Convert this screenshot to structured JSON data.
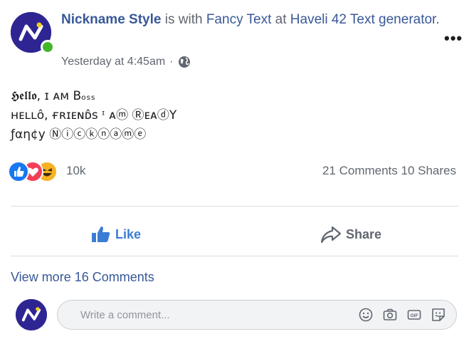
{
  "post": {
    "author": "Nickname Style",
    "with_text": "is with",
    "tagged": "Fancy Text",
    "at_text": "at",
    "place": "Haveli 42 Text generator.",
    "timestamp": "Yesterday at 4:45am",
    "dot": "·",
    "more": "•••",
    "lines": [
      "𝕳𝖊𝖑𝖑𝖔, ɪ ᴀᴍ Bₒₛₛ",
      "ʜᴇʟʟᴏ̂, ғʀɪᴇɴᴅ̂ꜱ ᶦ ᴀⓜ ⓇᴇᴀⓓY",
      "ƒαη¢у Ⓝⓘⓒⓚⓝⓐⓜⓔ"
    ],
    "reactions_count": "10k",
    "comments_shares": "21 Comments 10 Shares",
    "like_label": "Like",
    "share_label": "Share",
    "view_more": "View more 16 Comments",
    "comment_placeholder": "Write a comment...",
    "colors": {
      "brand_blue": "#385898",
      "like_blue": "#3b7cd6",
      "avatar": "#2e2593",
      "online": "#42b72a"
    },
    "icons": [
      "globe-icon",
      "like-icon",
      "share-icon",
      "emoji-icon",
      "camera-icon",
      "gif-icon",
      "sticker-icon"
    ]
  }
}
